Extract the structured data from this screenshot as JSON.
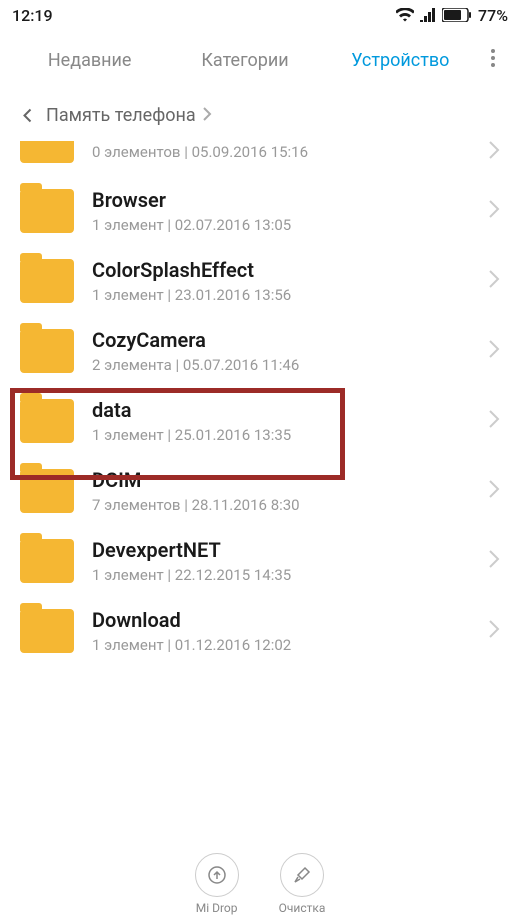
{
  "status_bar": {
    "time": "12:19",
    "battery_pct": "77%"
  },
  "tabs": {
    "recent": "Недавние",
    "categories": "Категории",
    "device": "Устройство"
  },
  "breadcrumb": {
    "label": "Память телефона"
  },
  "files": [
    {
      "name": "",
      "meta": "0 элементов | 05.09.2016 15:16",
      "partial": true
    },
    {
      "name": "Browser",
      "meta": "1 элемент | 02.07.2016 13:05"
    },
    {
      "name": "ColorSplashEffect",
      "meta": "1 элемент | 23.01.2016 13:56"
    },
    {
      "name": "CozyCamera",
      "meta": "2 элемента | 05.07.2016 11:46"
    },
    {
      "name": "data",
      "meta": "1 элемент | 25.01.2016 13:35",
      "highlighted": true
    },
    {
      "name": "DCIM",
      "meta": "7 элементов | 28.11.2016 8:30"
    },
    {
      "name": "DevexpertNET",
      "meta": "1 элемент | 22.12.2015 14:35"
    },
    {
      "name": "Download",
      "meta": "1 элемент | 01.12.2016 12:02"
    }
  ],
  "bottom_actions": {
    "midrop": "Mi Drop",
    "cleanup": "Очистка"
  }
}
